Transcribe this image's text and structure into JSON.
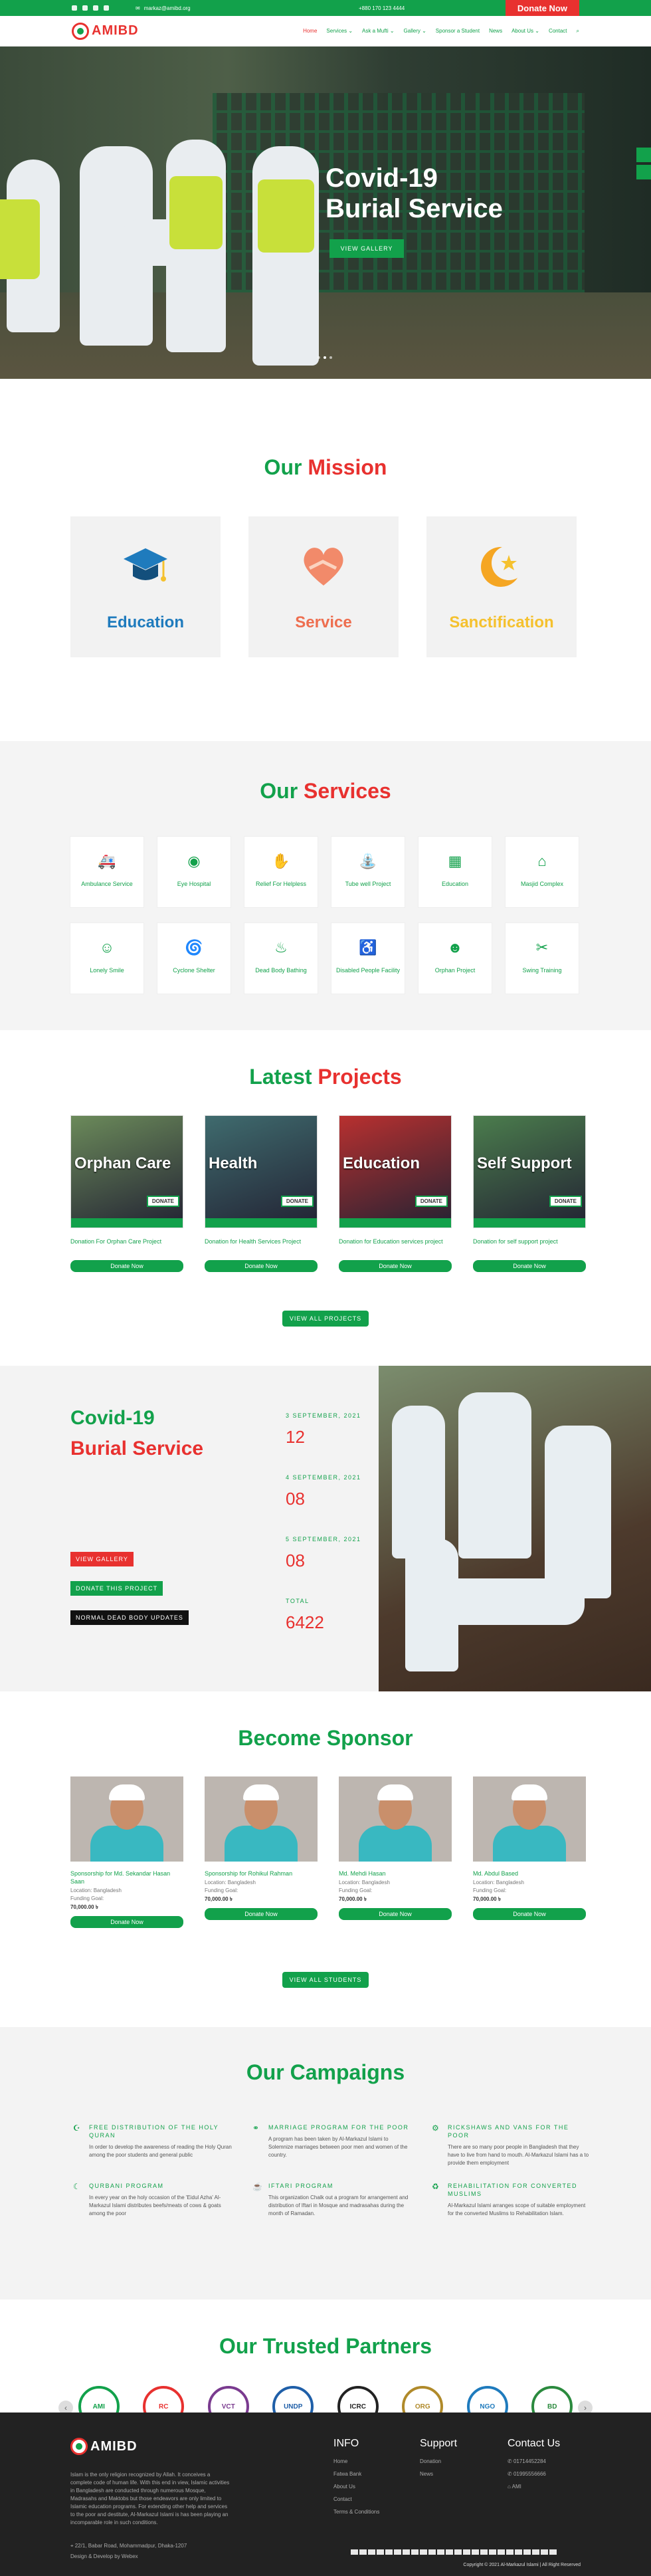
{
  "topbar": {
    "email": "markaz@amibd.org",
    "phone": "+880 170 123 4444",
    "donate": "Donate Now"
  },
  "brand": {
    "name": "AMIBD",
    "tagline": "ANJUMAN MUFIDUL ISLAM BANGLADESH"
  },
  "nav": [
    "Home",
    "Services ⌄",
    "Ask a Mufti ⌄",
    "Gallery ⌄",
    "Sponsor a Student",
    "News",
    "About Us ⌄",
    "Contact"
  ],
  "hero": {
    "title_line1": "Covid-19",
    "title_line2": "Burial Service",
    "button": "VIEW GALLERY"
  },
  "mission": {
    "title_green": "Our",
    "title_red": "Mission",
    "cards": [
      {
        "label": "Education",
        "color": "#1f7bbd"
      },
      {
        "label": "Service",
        "color": "#ee6e4f"
      },
      {
        "label": "Sanctification",
        "color": "#f5c12e"
      }
    ]
  },
  "services": {
    "title_green": "Our",
    "title_red": "Services",
    "items": [
      {
        "label": "Ambulance Service",
        "icon": "ambulance-icon"
      },
      {
        "label": "Eye Hospital",
        "icon": "eye-icon"
      },
      {
        "label": "Relief For Helpless",
        "icon": "relief-icon"
      },
      {
        "label": "Tube well Project",
        "icon": "tubewell-icon"
      },
      {
        "label": "Education",
        "icon": "education-icon"
      },
      {
        "label": "Masjid Complex",
        "icon": "mosque-icon"
      },
      {
        "label": "Lonely Smile",
        "icon": "smile-icon"
      },
      {
        "label": "Cyclone Shelter",
        "icon": "cyclone-icon"
      },
      {
        "label": "Dead Body Bathing",
        "icon": "bathing-icon"
      },
      {
        "label": "Disabled People Facility",
        "icon": "wheelchair-icon"
      },
      {
        "label": "Orphan Project",
        "icon": "orphan-icon"
      },
      {
        "label": "Swing Training",
        "icon": "sewing-icon"
      }
    ]
  },
  "projects": {
    "title_green": "Latest",
    "title_red": "Projects",
    "view_all": "VIEW ALL PROJECTS",
    "donate_label": "Donate Now",
    "items": [
      {
        "title": "Orphan Care",
        "badge": "DONATE",
        "caption": "Donation For Orphan Care Project",
        "bg": "#6b8a5a"
      },
      {
        "title": "Health",
        "badge": "DONATE",
        "caption": "Donation for Health Services Project",
        "bg": "#3f6b6e"
      },
      {
        "title": "Education",
        "badge": "DONATE",
        "caption": "Donation for Education services project",
        "bg": "#b8302f"
      },
      {
        "title": "Self Support",
        "badge": "DONATE",
        "caption": "Donation for self support project",
        "bg": "#4b7d4d"
      }
    ]
  },
  "covid": {
    "title_green": "Covid-19",
    "title_red": "Burial Service",
    "stats": [
      {
        "label": "3 SEPTEMBER, 2021",
        "value": "12"
      },
      {
        "label": "4 SEPTEMBER, 2021",
        "value": "08"
      },
      {
        "label": "5 SEPTEMBER, 2021",
        "value": "08"
      },
      {
        "label": "TOTAL",
        "value": "6422"
      }
    ],
    "buttons": [
      "VIEW GALLERY",
      "DONATE THIS PROJECT",
      "NORMAL DEAD BODY UPDATES"
    ]
  },
  "sponsor": {
    "title": "Become Sponsor",
    "view_all": "VIEW ALL STUDENTS",
    "donate_label": "Donate Now",
    "items": [
      {
        "name": "Sponsorship for Md. Sekandar Hasan Saan",
        "location": "Location: Bangladesh",
        "goal_label": "Funding Goal:",
        "goal": "70,000.00 ৳"
      },
      {
        "name": "Sponsorship for Rohikul Rahman",
        "location": "Location: Bangladesh",
        "goal_label": "Funding Goal:",
        "goal": "70,000.00 ৳"
      },
      {
        "name": "Md. Mehdi Hasan",
        "location": "Location: Bangladesh",
        "goal_label": "Funding Goal:",
        "goal": "70,000.00 ৳"
      },
      {
        "name": "Md. Abdul Based",
        "location": "Location: Bangladesh",
        "goal_label": "Funding Goal:",
        "goal": "70,000.00 ৳"
      }
    ]
  },
  "campaigns": {
    "title": "Our Campaigns",
    "items": [
      {
        "title": "FREE DISTRIBUTION OF THE HOLY QURAN",
        "text": "In order to develop the awareness of reading the Holy Quran among the poor students and general public"
      },
      {
        "title": "MARRIAGE PROGRAM FOR THE POOR",
        "text": "A program has been taken by Al-Markazul Islami to Solemnize marriages between poor men and women of the country."
      },
      {
        "title": "RICKSHAWS AND VANS FOR THE POOR",
        "text": "There are so many poor people in Bangladesh that they have to live from hand to mouth. Al-Markazul Islami has a to provide them employment"
      },
      {
        "title": "QURBANI PROGRAM",
        "text": "In every year on the holy occasion of the 'Eidul Azha' Al-Markazul Islami distributes beefs/meats of cows & goats among the poor"
      },
      {
        "title": "IFTARI PROGRAM",
        "text": "This organization Chalk out a program for arrangement and distribution of Iftari in Mosque and madrasahas during the month of Ramadan."
      },
      {
        "title": "REHABILITATION FOR CONVERTED MUSLIMS",
        "text": "Al-Markazul Islami arranges scope of suitable employment for the converted Muslims to Rehabilitation Islam."
      }
    ]
  },
  "partners": {
    "title": "Our Trusted Partners",
    "logos": [
      {
        "label": "AMI",
        "color": "#12a14b"
      },
      {
        "label": "RC",
        "color": "#e8312f"
      },
      {
        "label": "VCT",
        "color": "#7a3b8f"
      },
      {
        "label": "UNDP",
        "color": "#1f5fa8"
      },
      {
        "label": "ICRC",
        "color": "#222222"
      },
      {
        "label": "ORG",
        "color": "#b08a2a"
      },
      {
        "label": "NGO",
        "color": "#1f7bbd"
      },
      {
        "label": "BD",
        "color": "#2b8a3e"
      }
    ]
  },
  "footer": {
    "description": "Islam is the only religion recognized by Allah. It conceives a complete code of human life. With this end in view, Islamic activities in Bangladesh are conducted through numerous Mosque, Madrasahs and Maktobs but those endeavors are only limited to Islamic education programs. For extending other help and services to the poor and destitute, Al-Markazul Islami is has been playing an incomparable role in such conditions.",
    "address": "22/1, Babar Road, Mohammadpur, Dhaka-1207",
    "credit": "Design & Develop by Webex",
    "info_title": "INFO",
    "info": [
      "Home",
      "Fatwa Bank",
      "About Us",
      "Contact",
      "Terms & Conditions"
    ],
    "support_title": "Support",
    "support": [
      "Donation",
      "News"
    ],
    "contact_title": "Contact Us",
    "contact": [
      "01714452284",
      "01995556666",
      "AMI"
    ],
    "copyright": "Copyright © 2021 Al-Markazul Islami | All Right Reserved"
  }
}
